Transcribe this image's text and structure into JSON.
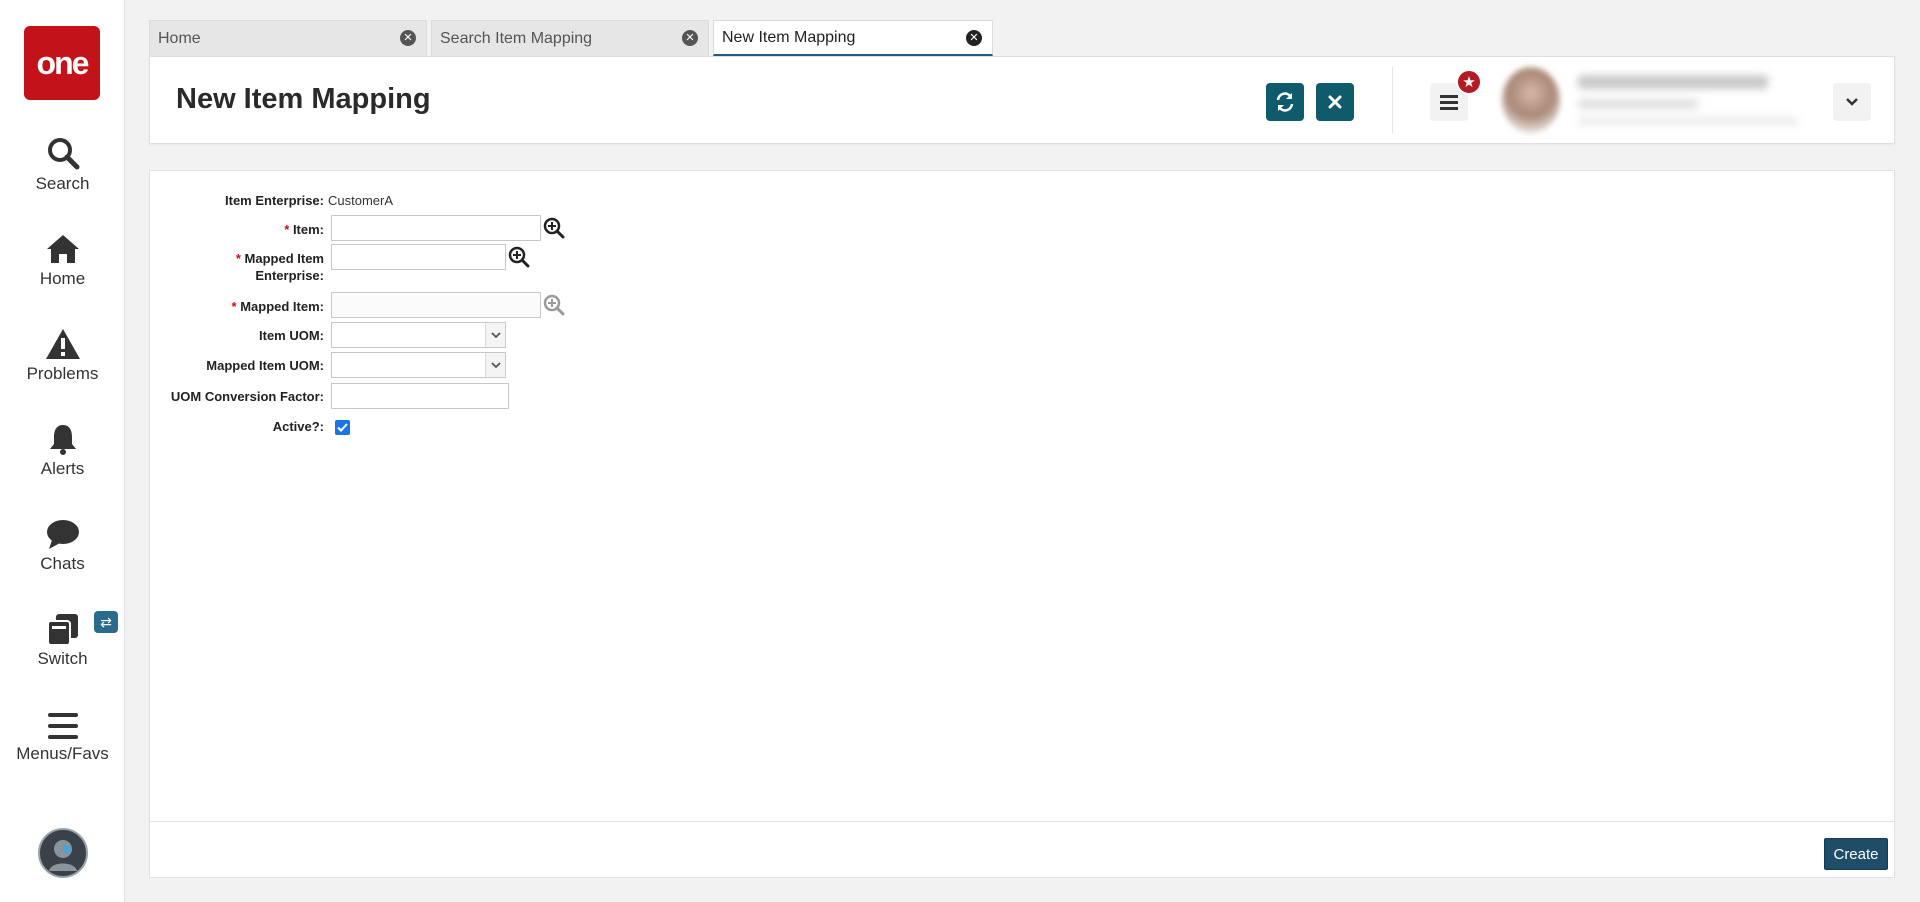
{
  "sidebar": {
    "logo_text": "one",
    "items": [
      {
        "label": "Search",
        "icon": "search-icon"
      },
      {
        "label": "Home",
        "icon": "home-icon"
      },
      {
        "label": "Problems",
        "icon": "warning-icon"
      },
      {
        "label": "Alerts",
        "icon": "bell-icon"
      },
      {
        "label": "Chats",
        "icon": "chat-icon"
      },
      {
        "label": "Switch",
        "icon": "switch-icon"
      },
      {
        "label": "Menus/Favs",
        "icon": "hamburger-icon"
      }
    ]
  },
  "tabs": [
    {
      "label": "Home",
      "active": false
    },
    {
      "label": "Search Item Mapping",
      "active": false
    },
    {
      "label": "New Item Mapping",
      "active": true
    }
  ],
  "header": {
    "title": "New Item Mapping"
  },
  "form": {
    "item_enterprise": {
      "label": "Item Enterprise:",
      "value": "CustomerA"
    },
    "item": {
      "label": "Item:",
      "required_mark": "*",
      "value": ""
    },
    "mapped_item_enterprise": {
      "label_line1": "Mapped Item",
      "label_line2": "Enterprise:",
      "required_mark": "*",
      "value": ""
    },
    "mapped_item": {
      "label": "Mapped Item:",
      "required_mark": "*",
      "value": ""
    },
    "item_uom": {
      "label": "Item UOM:",
      "value": ""
    },
    "mapped_item_uom": {
      "label": "Mapped Item UOM:",
      "value": ""
    },
    "uom_conversion_factor": {
      "label": "UOM Conversion Factor:",
      "value": ""
    },
    "active": {
      "label": "Active?:",
      "checked": true
    }
  },
  "footer": {
    "create_label": "Create"
  },
  "colors": {
    "brand_red": "#c4121a",
    "action_teal": "#0f5a6b",
    "create_blue": "#1f4d68",
    "checkbox_blue": "#1a73e8"
  }
}
